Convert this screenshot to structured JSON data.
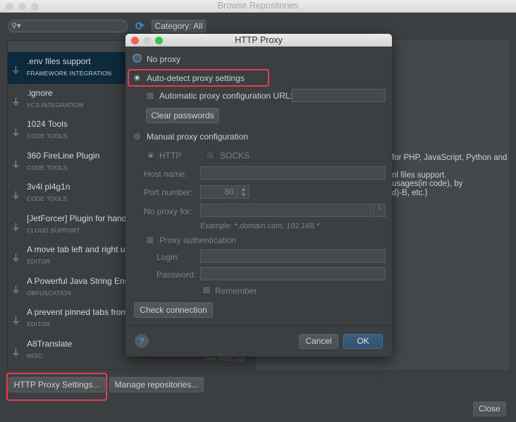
{
  "window": {
    "title": "Browse Repositories"
  },
  "toolbar": {
    "category_label": "Category: All ▾"
  },
  "plugins": [
    {
      "name": ".env files support",
      "category": "FRAMEWORK INTEGRATION"
    },
    {
      "name": ".ignore",
      "category": "VCS INTEGRATION"
    },
    {
      "name": "1024 Tools",
      "category": "CODE TOOLS"
    },
    {
      "name": "360 FireLine Plugin",
      "category": "CODE TOOLS"
    },
    {
      "name": "3v4l pl4g1n",
      "category": "CODE TOOLS"
    },
    {
      "name": "[JetForcer] Plugin for handy",
      "category": "CLOUD SUPPORT"
    },
    {
      "name": "A move tab left and right usi",
      "category": "EDITOR"
    },
    {
      "name": "A Powerful Java String Encr",
      "category": "OBFUSCATION"
    },
    {
      "name": "A prevent pinned tabs from c",
      "category": "EDITOR"
    },
    {
      "name": "A8Translate",
      "category": "MISC"
    },
    {
      "name": "A8Translate",
      "category": ""
    }
  ],
  "list_date": "one month ago",
  "detail": {
    "lines": [
      "for PHP, JavaScript, Python and",
      "nl files support.",
      "usages(in code), by",
      "d)-B, etc.)"
    ]
  },
  "buttons": {
    "proxy": "HTTP Proxy Settings...",
    "manage": "Manage repositories...",
    "close": "Close"
  },
  "dialog": {
    "title": "HTTP Proxy",
    "no_proxy": "No proxy",
    "auto_detect": "Auto-detect proxy settings",
    "auto_url": "Automatic proxy configuration URL:",
    "clear_passwords": "Clear passwords",
    "manual": "Manual proxy configuration",
    "http": "HTTP",
    "socks": "SOCKS",
    "host_label": "Host name:",
    "port_label": "Port number:",
    "port_value": "80",
    "no_proxy_for": "No proxy for:",
    "example": "Example: *.domain.com, 192.168.*",
    "proxy_auth": "Proxy authentication",
    "login": "Login:",
    "password": "Password:",
    "remember": "Remember",
    "check": "Check connection",
    "help": "?",
    "cancel": "Cancel",
    "ok": "OK",
    "selected": "auto_detect"
  }
}
